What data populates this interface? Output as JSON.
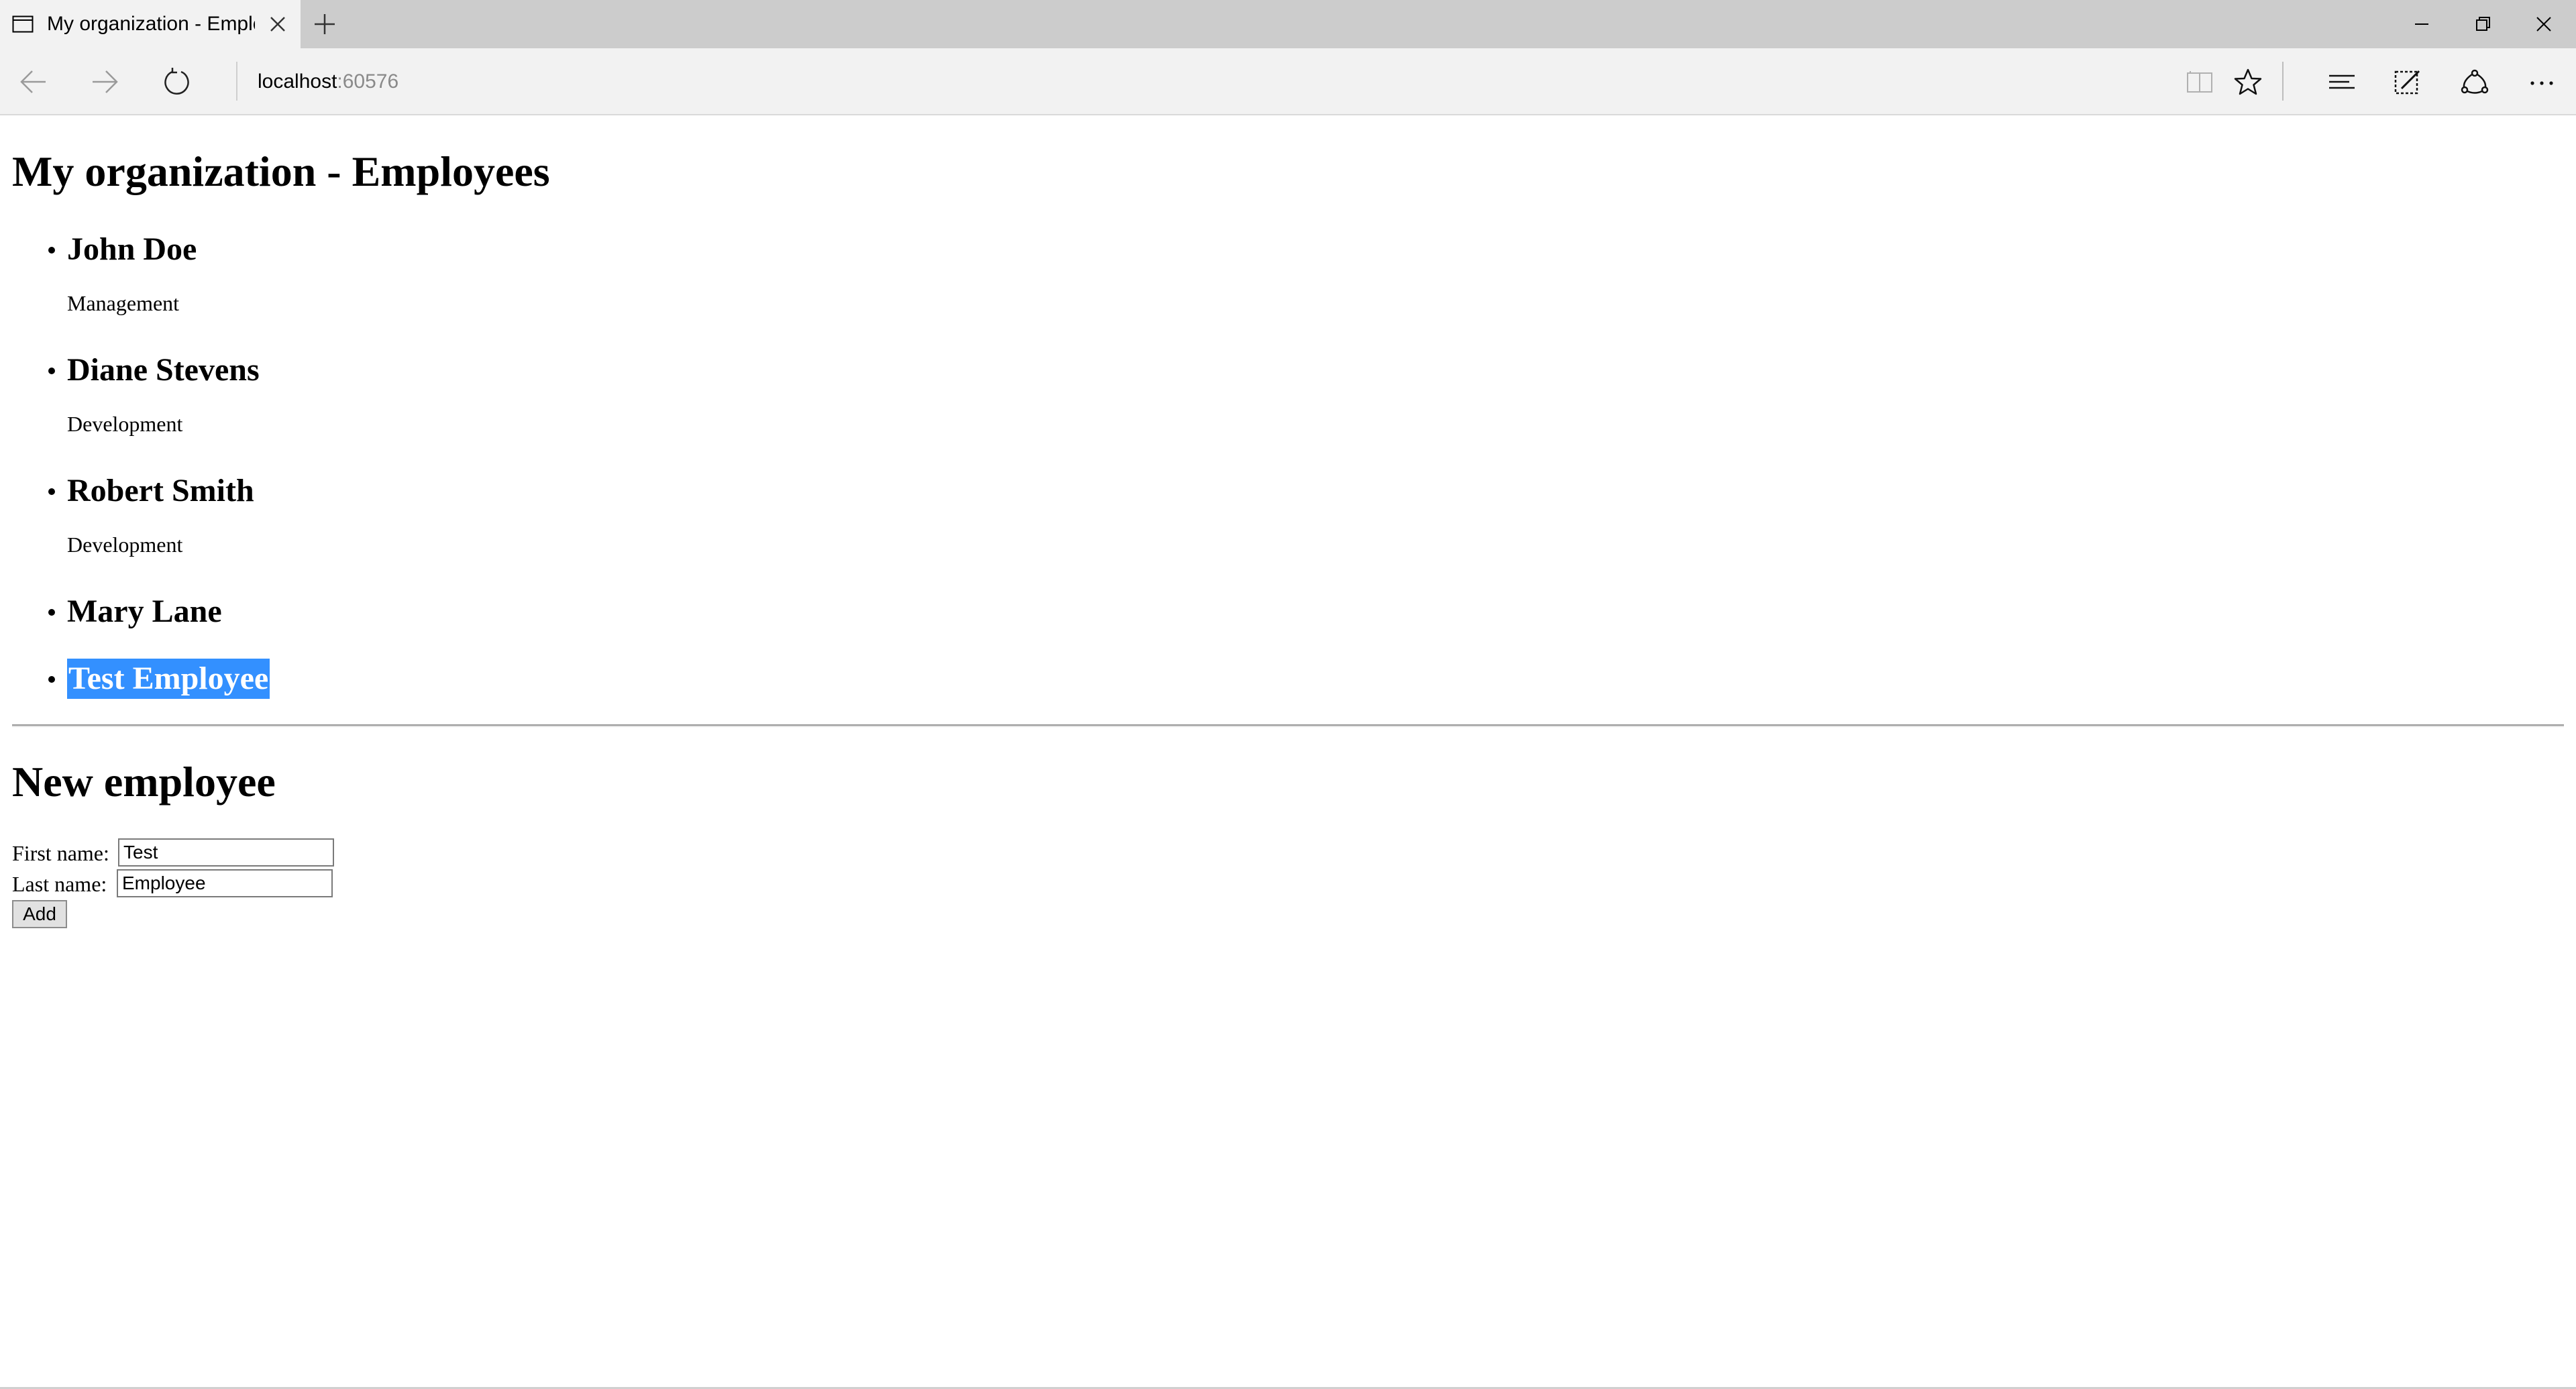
{
  "browser": {
    "tab_title": "My organization - Employees",
    "address_host": "localhost",
    "address_port": ":60576",
    "icons": {
      "tab_page": "page-icon",
      "tab_close": "close-icon",
      "new_tab": "plus-icon",
      "back": "arrow-left-icon",
      "forward": "arrow-right-icon",
      "refresh": "refresh-icon",
      "reading_view": "book-icon",
      "favorite": "star-icon",
      "hub": "hub-icon",
      "web_note": "pen-icon",
      "share": "share-icon",
      "more": "ellipsis-icon",
      "minimize": "minimize-icon",
      "restore": "restore-icon",
      "close": "close-icon"
    }
  },
  "page": {
    "title": "My organization - Employees",
    "employees": [
      {
        "name": "John Doe",
        "department": "Management"
      },
      {
        "name": "Diane Stevens",
        "department": "Development"
      },
      {
        "name": "Robert Smith",
        "department": "Development"
      },
      {
        "name": "Mary Lane",
        "department": ""
      },
      {
        "name": "Test Employee",
        "department": "",
        "selected": true
      }
    ],
    "form": {
      "title": "New employee",
      "first_name_label": "First name:",
      "first_name_value": "Test",
      "last_name_label": "Last name:",
      "last_name_value": "Employee",
      "add_label": "Add"
    }
  },
  "colors": {
    "selection": "#3390ff",
    "chrome_background": "#cccccc",
    "toolbar_background": "#f2f2f2"
  }
}
